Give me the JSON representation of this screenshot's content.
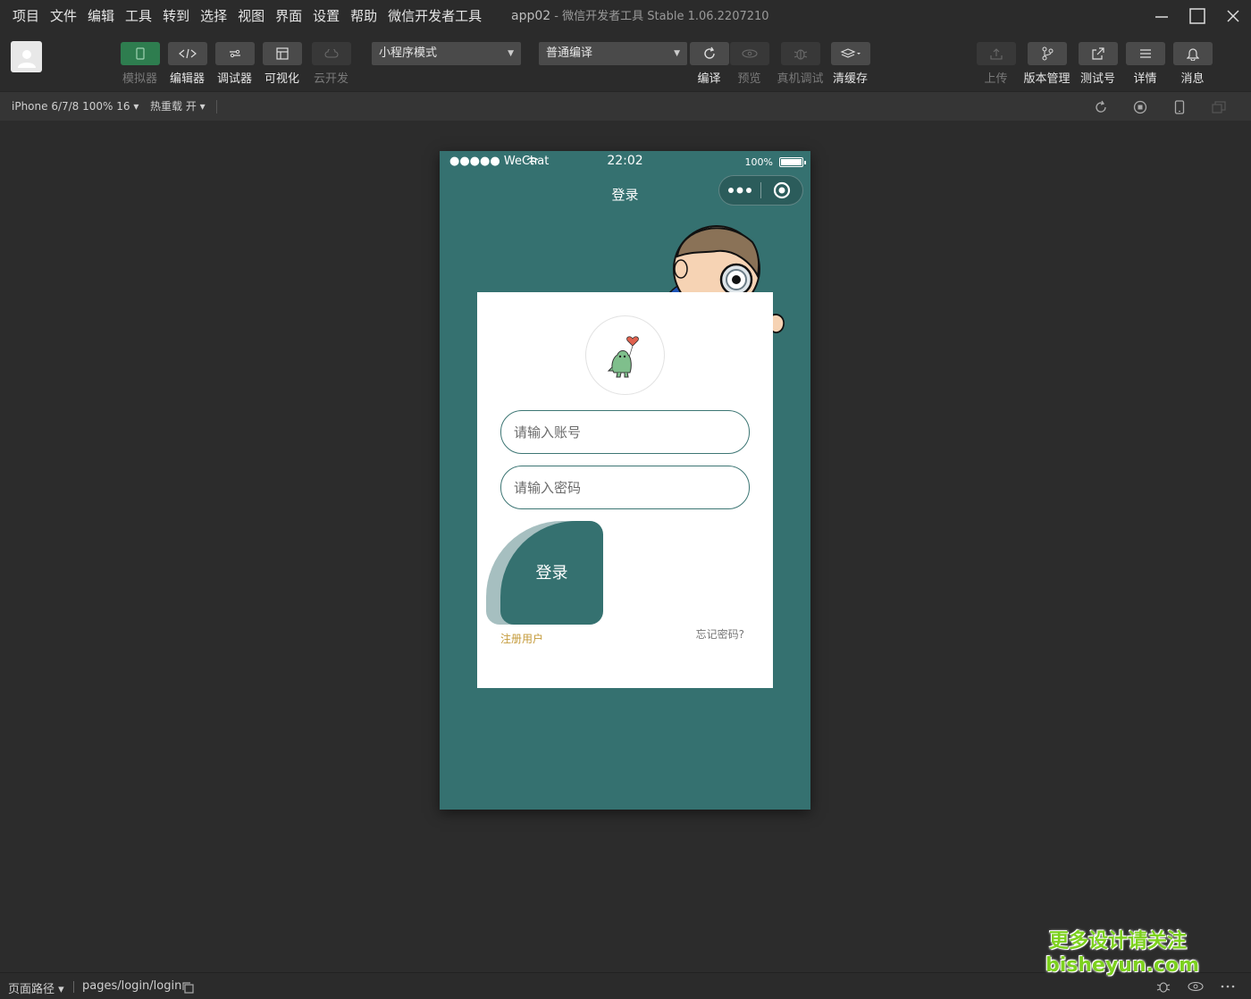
{
  "menubar": {
    "items": [
      "项目",
      "文件",
      "编辑",
      "工具",
      "转到",
      "选择",
      "视图",
      "界面",
      "设置",
      "帮助",
      "微信开发者工具"
    ],
    "app_name": "app02",
    "app_title": " - 微信开发者工具 Stable 1.06.2207210"
  },
  "toolbar": {
    "simulator": "模拟器",
    "editor": "编辑器",
    "debugger": "调试器",
    "visual": "可视化",
    "cloud": "云开发",
    "mode_select": "小程序模式",
    "compile_select": "普通编译",
    "compile": "编译",
    "preview": "预览",
    "device_debug": "真机调试",
    "clear_cache": "清缓存",
    "upload": "上传",
    "version": "版本管理",
    "test_account": "测试号",
    "details": "详情",
    "messages": "消息"
  },
  "subbar": {
    "device": "iPhone 6/7/8 100% 16 ▾",
    "hot_reload": "热重载 开 ▾"
  },
  "phone": {
    "carrier": "●●●●● WeChat",
    "time": "22:02",
    "battery": "100%",
    "nav_title": "登录",
    "account_placeholder": "请输入账号",
    "password_placeholder": "请输入密码",
    "login_button": "登录",
    "register": "注册用户",
    "forgot": "忘记密码?",
    "theme_color": "#357170"
  },
  "bottombar": {
    "path_label": "页面路径 ▾",
    "path": "pages/login/login"
  },
  "watermark": {
    "line1": "更多设计请关注",
    "line2": "bisheyun.com"
  }
}
